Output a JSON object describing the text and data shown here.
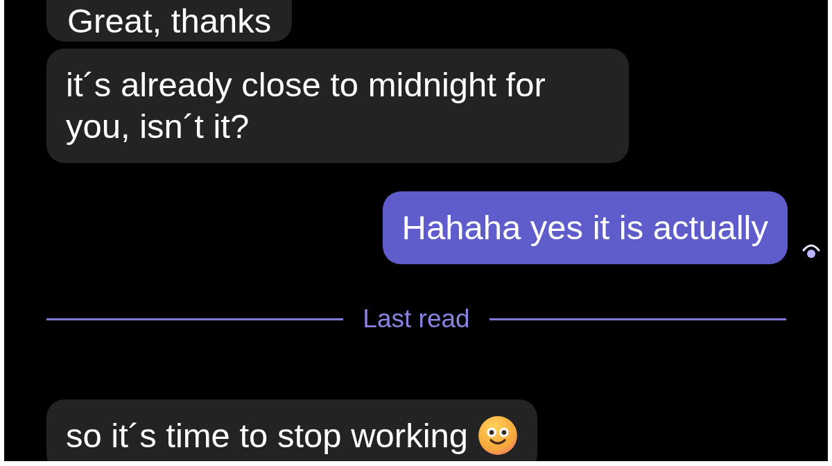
{
  "messages": [
    {
      "kind": "incoming",
      "text": "Great, thanks"
    },
    {
      "kind": "incoming",
      "text": "it´s already close to midnight for you, isn´t it?"
    },
    {
      "kind": "outgoing",
      "text": "Hahaha yes it is actually",
      "seen": true
    },
    {
      "kind": "divider",
      "text": "Last read"
    },
    {
      "kind": "incoming",
      "text": "so it´s time to stop working",
      "emoji": true
    }
  ]
}
